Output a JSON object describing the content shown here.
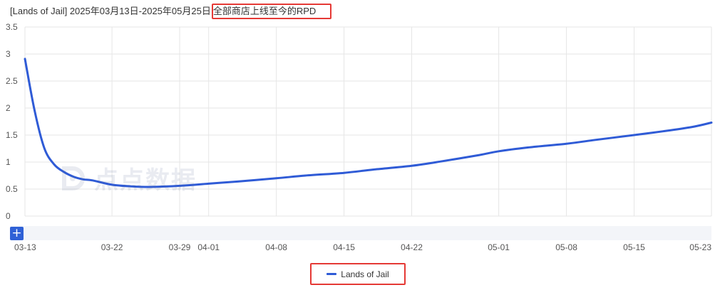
{
  "title": {
    "prefix": "[Lands of Jail] 2025年03月13日-2025年05月25日",
    "highlighted": "全部商店上线至今的RPD"
  },
  "zoom_button": {
    "label": "+"
  },
  "watermark": {
    "text": "点点数据"
  },
  "colors": {
    "series": "#2f5bd6",
    "highlight_box": "#e53935",
    "grid": "#e6e6e6",
    "navigator_bg": "#f3f5f9"
  },
  "chart_data": {
    "type": "line",
    "title": "[Lands of Jail] 2025年03月13日-2025年05月25日全部商店上线至今的RPD",
    "xlabel": "",
    "ylabel": "",
    "ylim": [
      0,
      3.5
    ],
    "y_ticks": [
      "0",
      "0.5",
      "1",
      "1.5",
      "2",
      "2.5",
      "3",
      "3.5"
    ],
    "x_ticks": [
      "03-13",
      "03-22",
      "03-29",
      "04-01",
      "04-08",
      "04-15",
      "04-22",
      "05-01",
      "05-08",
      "05-15",
      "05-23"
    ],
    "grid": true,
    "legend_position": "bottom-center",
    "series": [
      {
        "name": "Lands of Jail",
        "x": [
          "03-13",
          "03-14",
          "03-15",
          "03-16",
          "03-17",
          "03-18",
          "03-19",
          "03-20",
          "03-22",
          "03-24",
          "03-26",
          "03-29",
          "04-01",
          "04-04",
          "04-08",
          "04-11",
          "04-15",
          "04-18",
          "04-22",
          "04-25",
          "04-29",
          "05-01",
          "05-04",
          "05-08",
          "05-11",
          "05-15",
          "05-18",
          "05-21",
          "05-23"
        ],
        "values": [
          2.91,
          1.95,
          1.26,
          0.96,
          0.82,
          0.73,
          0.68,
          0.66,
          0.58,
          0.55,
          0.54,
          0.56,
          0.6,
          0.64,
          0.7,
          0.75,
          0.8,
          0.86,
          0.93,
          1.01,
          1.13,
          1.2,
          1.27,
          1.34,
          1.41,
          1.5,
          1.57,
          1.65,
          1.73
        ]
      }
    ]
  }
}
